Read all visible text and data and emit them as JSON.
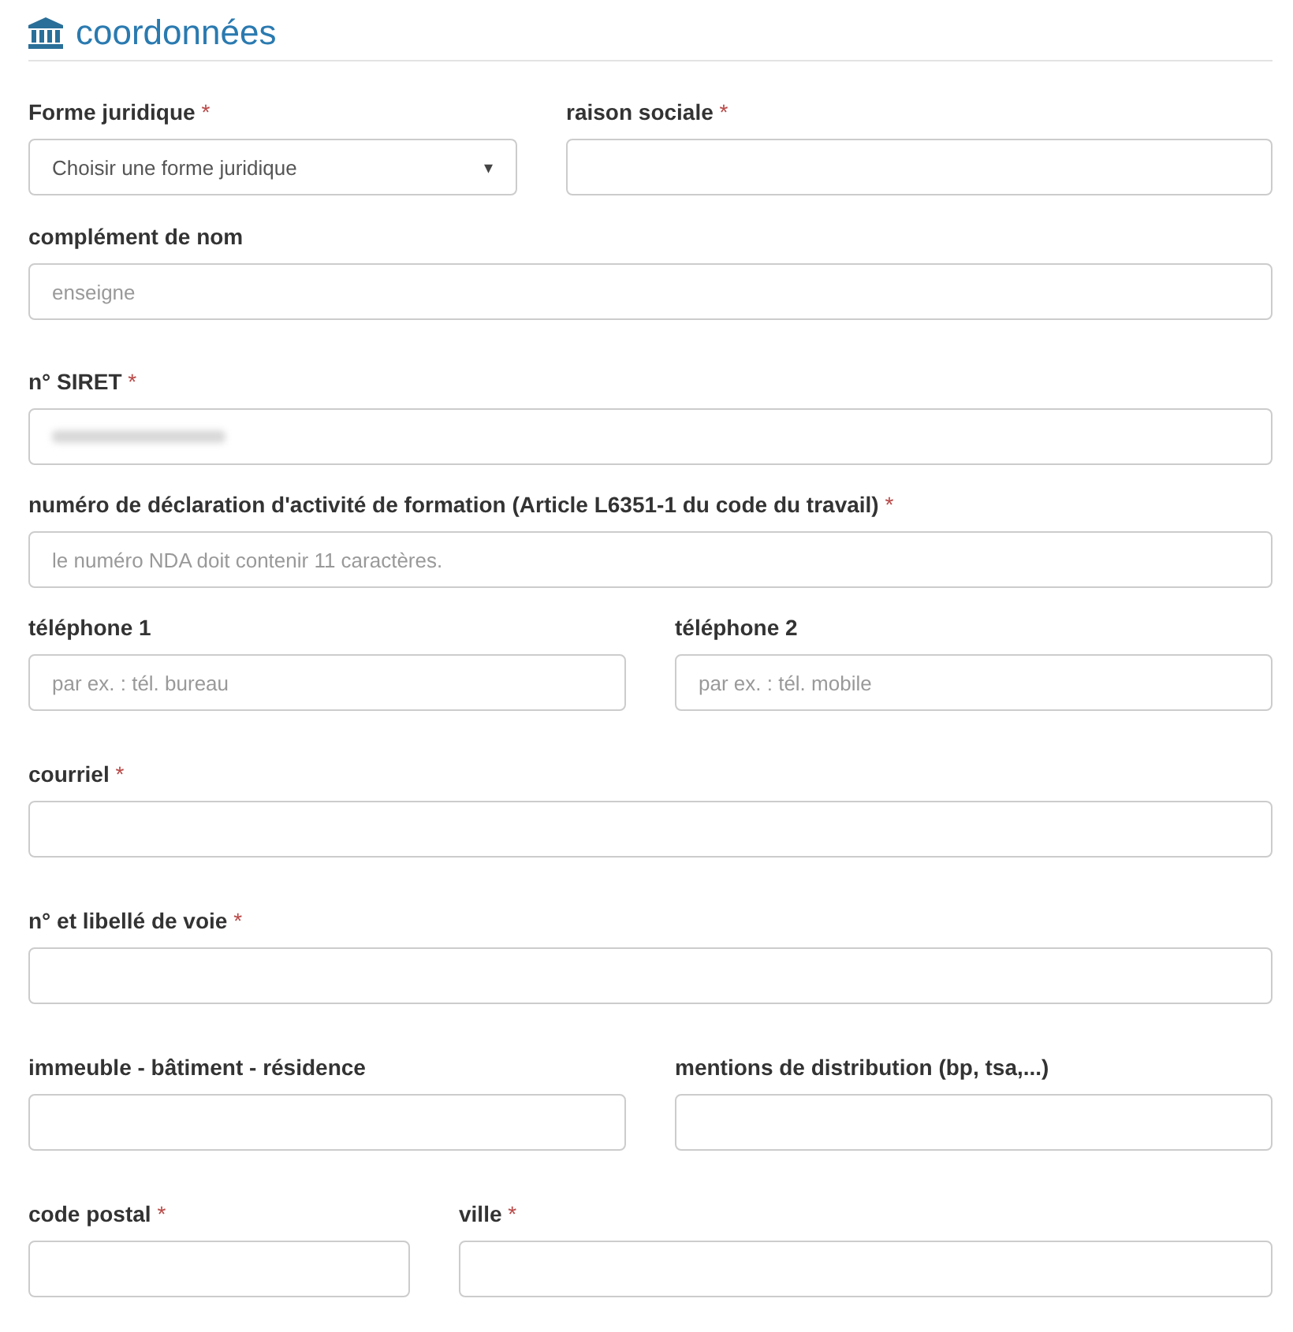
{
  "section": {
    "title": "coordonnées"
  },
  "rows": [
    {
      "fields": [
        {
          "kind": "select",
          "label": "Forme juridique",
          "required_mark": "*",
          "value": "Choisir une forme juridique",
          "caret": "▾"
        },
        {
          "kind": "text",
          "label": "raison sociale",
          "required_mark": "*"
        }
      ]
    },
    {
      "fields": [
        {
          "kind": "text",
          "label": "complément de nom",
          "placeholder": "enseigne"
        }
      ]
    },
    {
      "fields": [
        {
          "kind": "redacted",
          "label": "n° SIRET",
          "required_mark": "*"
        }
      ]
    },
    {
      "fields": [
        {
          "kind": "text",
          "label": "numéro de déclaration d'activité de formation (Article L6351-1 du code du travail)",
          "required_mark": "*",
          "placeholder": "le numéro NDA doit contenir 11 caractères."
        }
      ]
    },
    {
      "fields": [
        {
          "kind": "text",
          "label": "téléphone 1",
          "placeholder": "par ex. : tél. bureau"
        },
        {
          "kind": "text",
          "label": "téléphone 2",
          "placeholder": "par ex. : tél. mobile"
        }
      ]
    },
    {
      "fields": [
        {
          "kind": "text",
          "label": "courriel",
          "required_mark": "*"
        }
      ]
    },
    {
      "fields": [
        {
          "kind": "text",
          "label": "n° et libellé de voie",
          "required_mark": "*"
        }
      ]
    },
    {
      "fields": [
        {
          "kind": "text",
          "label": "immeuble - bâtiment - résidence"
        },
        {
          "kind": "text",
          "label": "mentions de distribution (bp, tsa,...)"
        }
      ]
    },
    {
      "fields": [
        {
          "kind": "text",
          "label": "code postal",
          "required_mark": "*"
        },
        {
          "kind": "text",
          "label": "ville",
          "required_mark": "*"
        }
      ]
    }
  ]
}
